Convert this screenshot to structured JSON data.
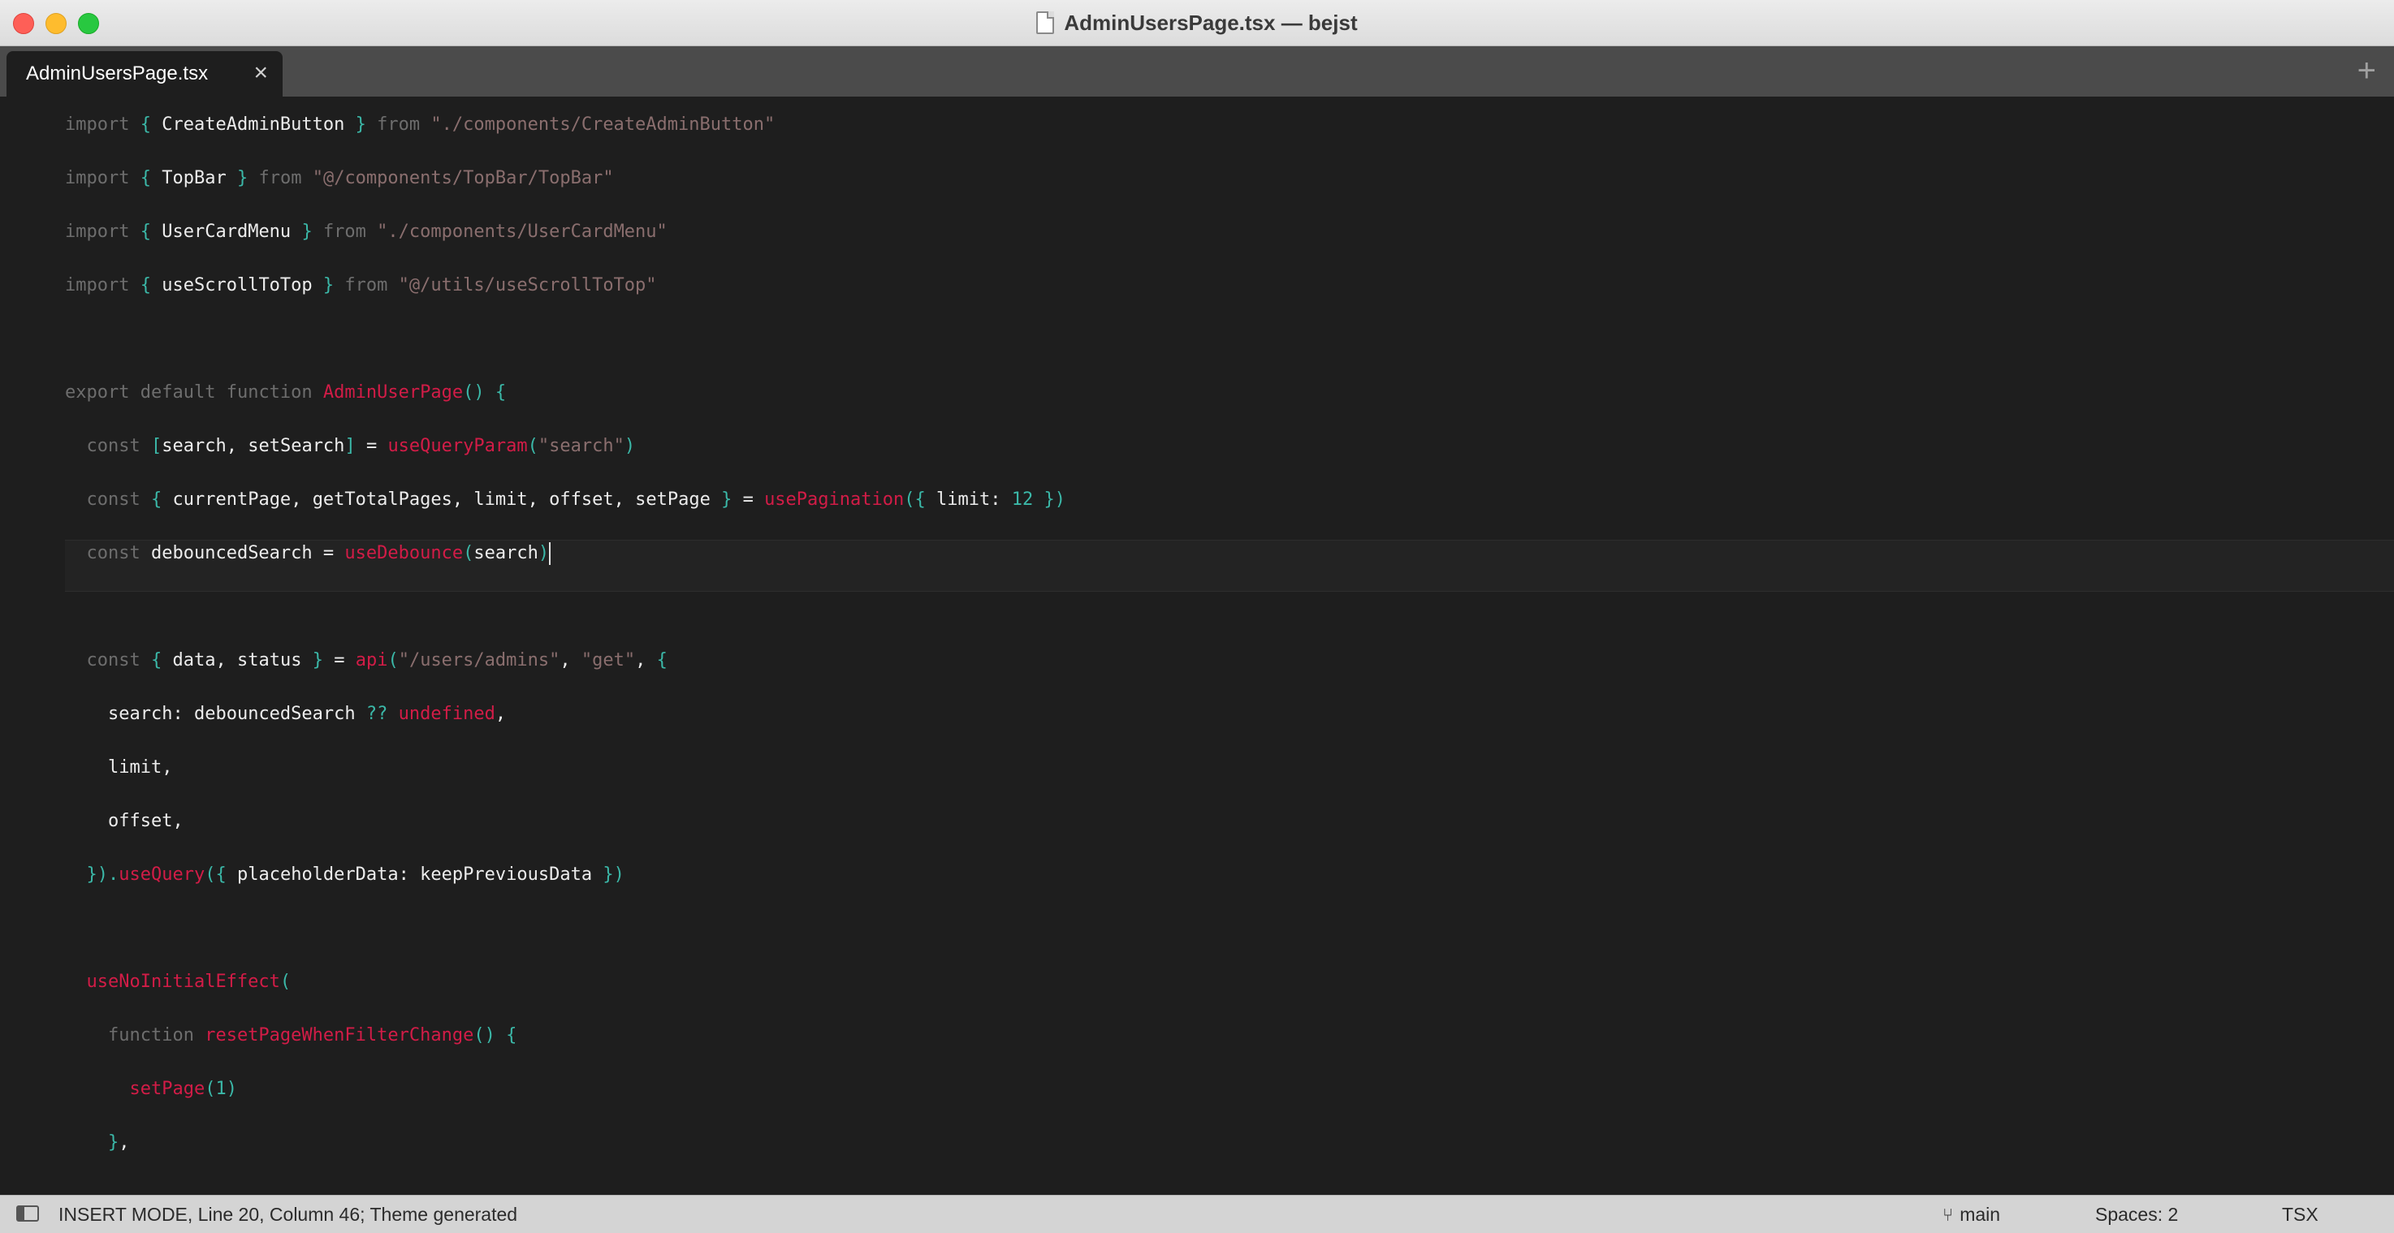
{
  "window": {
    "title": "AdminUsersPage.tsx — bejst"
  },
  "tabs": [
    {
      "label": "AdminUsersPage.tsx",
      "close": "×"
    }
  ],
  "tabbar": {
    "add": "+"
  },
  "editor": {
    "line_count": 20,
    "code_lines": [
      "import { CreateAdminButton } from \"./components/CreateAdminButton\"",
      "import { TopBar } from \"@/components/TopBar/TopBar\"",
      "import { UserCardMenu } from \"./components/UserCardMenu\"",
      "import { useScrollToTop } from \"@/utils/useScrollToTop\"",
      "",
      "export default function AdminUserPage() {",
      "  const [search, setSearch] = useQueryParam(\"search\")",
      "  const { currentPage, getTotalPages, limit, offset, setPage } = usePagination({ limit: 12 })",
      "  const debouncedSearch = useDebounce(search)",
      "",
      "  const { data, status } = api(\"/users/admins\", \"get\", {",
      "    search: debouncedSearch ?? undefined,",
      "    limit,",
      "    offset,",
      "  }).useQuery({ placeholderData: keepPreviousData })",
      "",
      "  useNoInitialEffect(",
      "    function resetPageWhenFilterChange() {",
      "      setPage(1)",
      "    },"
    ]
  },
  "statusbar": {
    "mode_text": "INSERT MODE, Line 20, Column 46; Theme generated",
    "branch": "main",
    "spaces": "Spaces: 2",
    "syntax": "TSX"
  },
  "colors": {
    "keyword": "#6d6d6d",
    "string": "#8a6e6e",
    "function": "#d21c47",
    "bracket": "#3bb8a8",
    "identifier": "#ececec",
    "background": "#1e1e1e"
  }
}
